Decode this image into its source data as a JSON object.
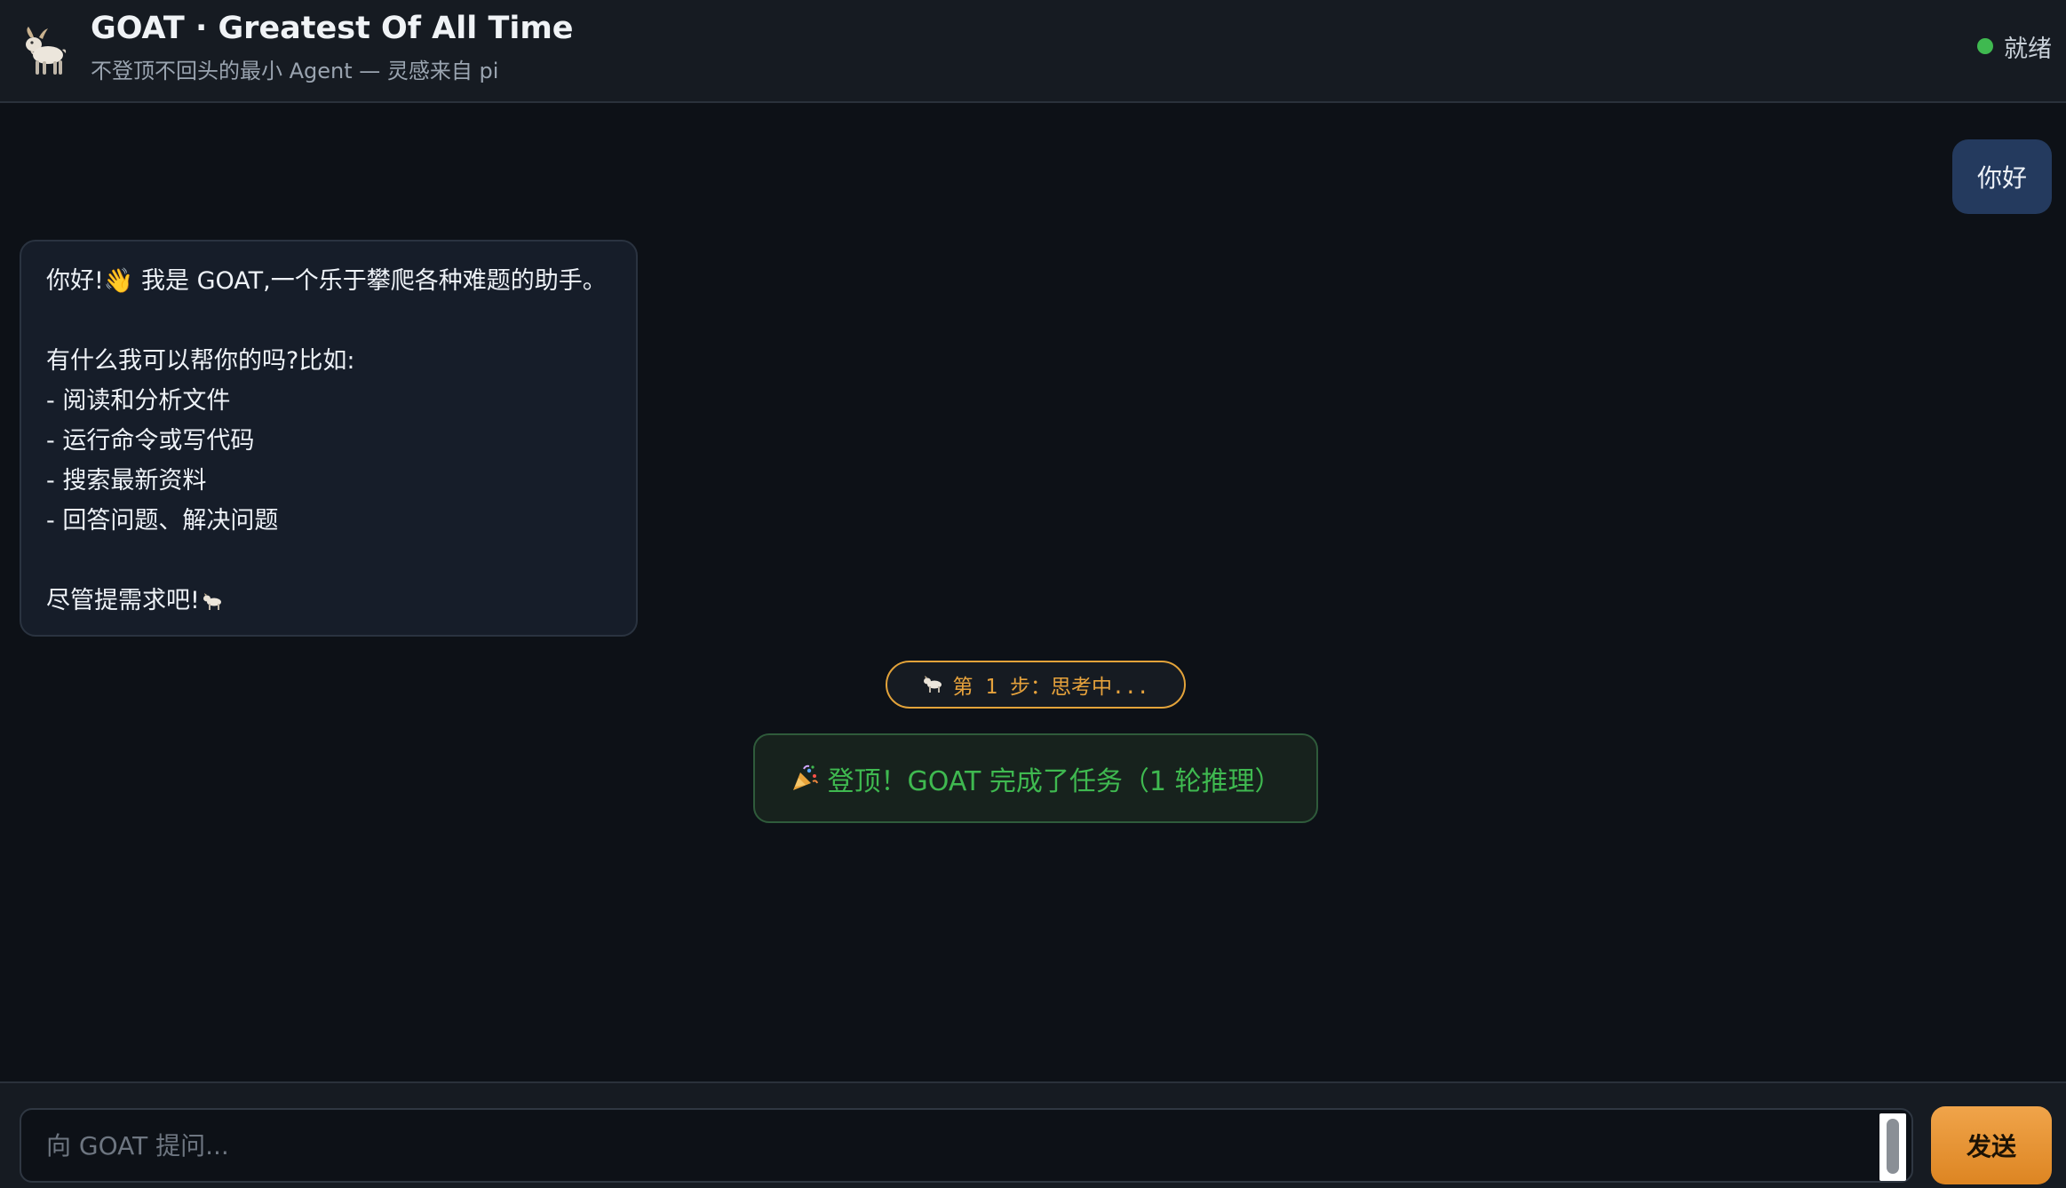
{
  "header": {
    "title": "GOAT · Greatest Of All Time",
    "subtitle": "不登顶不回头的最小 Agent — 灵感来自 pi",
    "status_label": "就绪",
    "status_color": "#3fb950",
    "logo_icon": "goat-icon"
  },
  "messages": {
    "user": "你好",
    "assistant_lines": [
      "你好!👋 我是 GOAT,一个乐于攀爬各种难题的助手。",
      "",
      "有什么我可以帮你的吗?比如:",
      "- 阅读和分析文件",
      "- 运行命令或写代码",
      "- 搜索最新资料",
      "- 回答问题、解决问题",
      "",
      "尽管提需求吧!"
    ]
  },
  "step": {
    "label": "第 1 步：思考中..."
  },
  "done": {
    "label": "登顶！GOAT 完成了任务（1 轮推理）"
  },
  "composer": {
    "placeholder": "向 GOAT 提问...",
    "value": "",
    "send_label": "发送"
  },
  "colors": {
    "accent_orange": "#e6a23c",
    "success_green": "#3fb950",
    "user_bubble": "#243a5e"
  }
}
